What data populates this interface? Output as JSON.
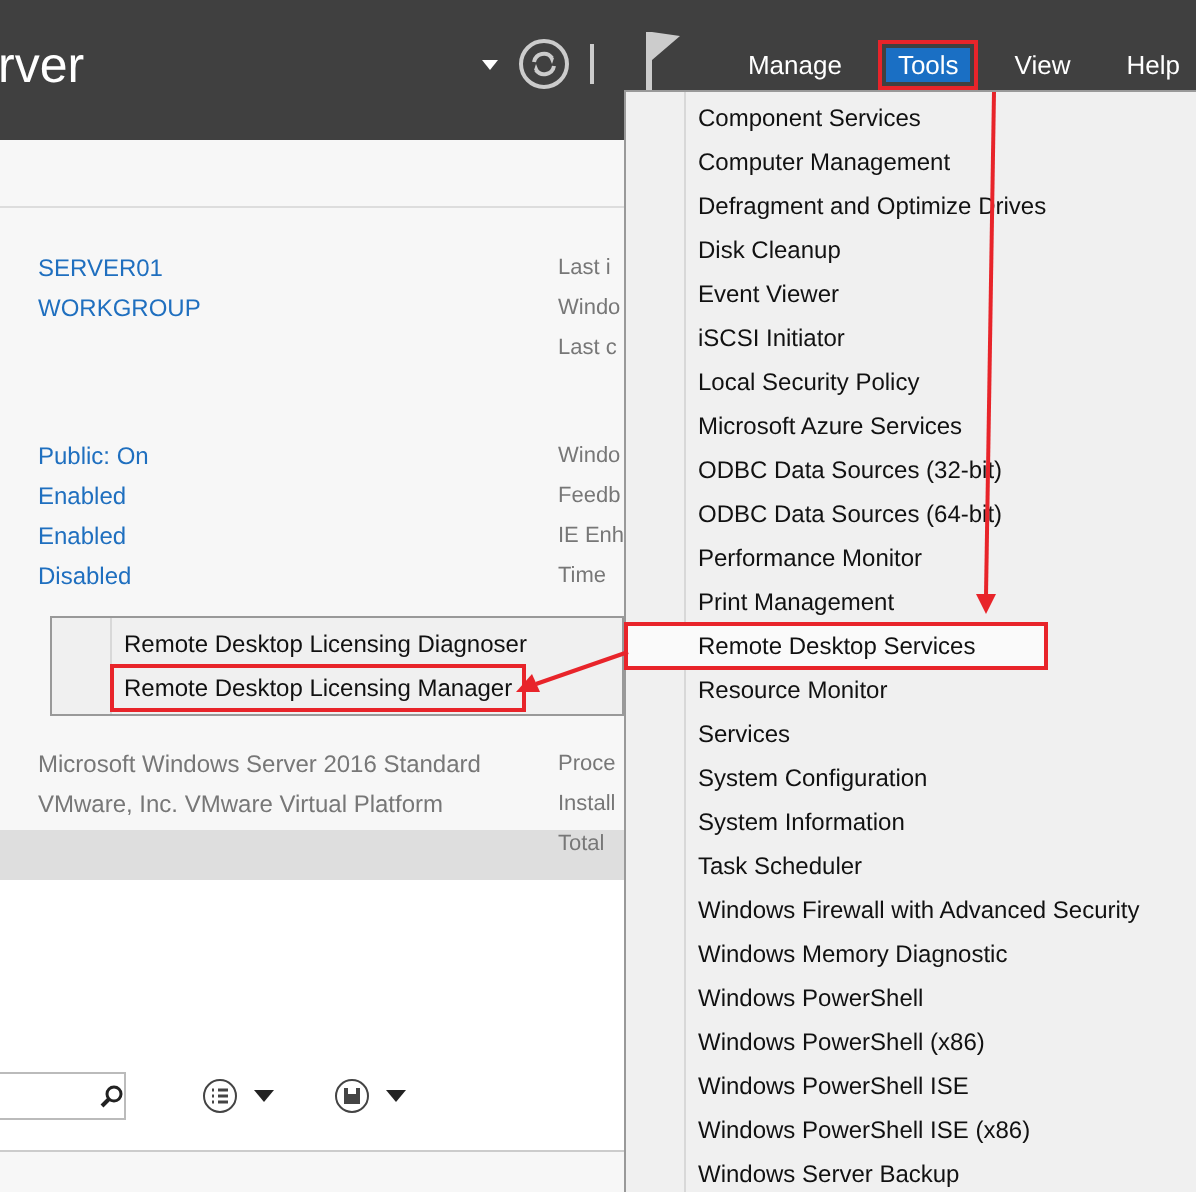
{
  "header": {
    "title": "rver",
    "menus": [
      {
        "label": "Manage",
        "selected": false,
        "annotated": false
      },
      {
        "label": "Tools",
        "selected": true,
        "annotated": true
      },
      {
        "label": "View",
        "selected": false,
        "annotated": false
      },
      {
        "label": "Help",
        "selected": false,
        "annotated": false
      }
    ]
  },
  "property_groups": [
    [
      {
        "value": "SERVER01",
        "label": "Last i",
        "kind": "link"
      },
      {
        "value": "WORKGROUP",
        "label": "Windo",
        "kind": "link"
      },
      {
        "label": "Last c"
      }
    ],
    [
      {
        "value": "Public: On",
        "label": "Windo",
        "kind": "link"
      },
      {
        "value": "Enabled",
        "label": "Feedb",
        "kind": "link"
      },
      {
        "value": "Enabled",
        "label": "IE Enh",
        "kind": "link"
      },
      {
        "value": "Disabled",
        "label": "Time",
        "kind": "link"
      }
    ],
    [
      {
        "value": "Microsoft Windows Server 2016 Standard",
        "label": "Proce",
        "kind": "text"
      },
      {
        "value": "VMware, Inc. VMware Virtual Platform",
        "label": "Install",
        "kind": "text"
      },
      {
        "label": "Total"
      }
    ]
  ],
  "tools_menu": [
    {
      "label": "Component Services",
      "selected": false,
      "annotated": false
    },
    {
      "label": "Computer Management",
      "selected": false,
      "annotated": false
    },
    {
      "label": "Defragment and Optimize Drives",
      "selected": false,
      "annotated": false
    },
    {
      "label": "Disk Cleanup",
      "selected": false,
      "annotated": false
    },
    {
      "label": "Event Viewer",
      "selected": false,
      "annotated": false
    },
    {
      "label": "iSCSI Initiator",
      "selected": false,
      "annotated": false
    },
    {
      "label": "Local Security Policy",
      "selected": false,
      "annotated": false
    },
    {
      "label": "Microsoft Azure Services",
      "selected": false,
      "annotated": false
    },
    {
      "label": "ODBC Data Sources (32-bit)",
      "selected": false,
      "annotated": false
    },
    {
      "label": "ODBC Data Sources (64-bit)",
      "selected": false,
      "annotated": false
    },
    {
      "label": "Performance Monitor",
      "selected": false,
      "annotated": false
    },
    {
      "label": "Print Management",
      "selected": false,
      "annotated": false
    },
    {
      "label": "Remote Desktop Services",
      "selected": true,
      "annotated": true
    },
    {
      "label": "Resource Monitor",
      "selected": false,
      "annotated": false
    },
    {
      "label": "Services",
      "selected": false,
      "annotated": false
    },
    {
      "label": "System Configuration",
      "selected": false,
      "annotated": false
    },
    {
      "label": "System Information",
      "selected": false,
      "annotated": false
    },
    {
      "label": "Task Scheduler",
      "selected": false,
      "annotated": false
    },
    {
      "label": "Windows Firewall with Advanced Security",
      "selected": false,
      "annotated": false
    },
    {
      "label": "Windows Memory Diagnostic",
      "selected": false,
      "annotated": false
    },
    {
      "label": "Windows PowerShell",
      "selected": false,
      "annotated": false
    },
    {
      "label": "Windows PowerShell (x86)",
      "selected": false,
      "annotated": false
    },
    {
      "label": "Windows PowerShell ISE",
      "selected": false,
      "annotated": false
    },
    {
      "label": "Windows PowerShell ISE (x86)",
      "selected": false,
      "annotated": false
    },
    {
      "label": "Windows Server Backup",
      "selected": false,
      "annotated": false
    }
  ],
  "submenu": [
    {
      "label": "Remote Desktop Licensing Diagnoser",
      "annotated": false
    },
    {
      "label": "Remote Desktop Licensing Manager",
      "annotated": true
    }
  ]
}
